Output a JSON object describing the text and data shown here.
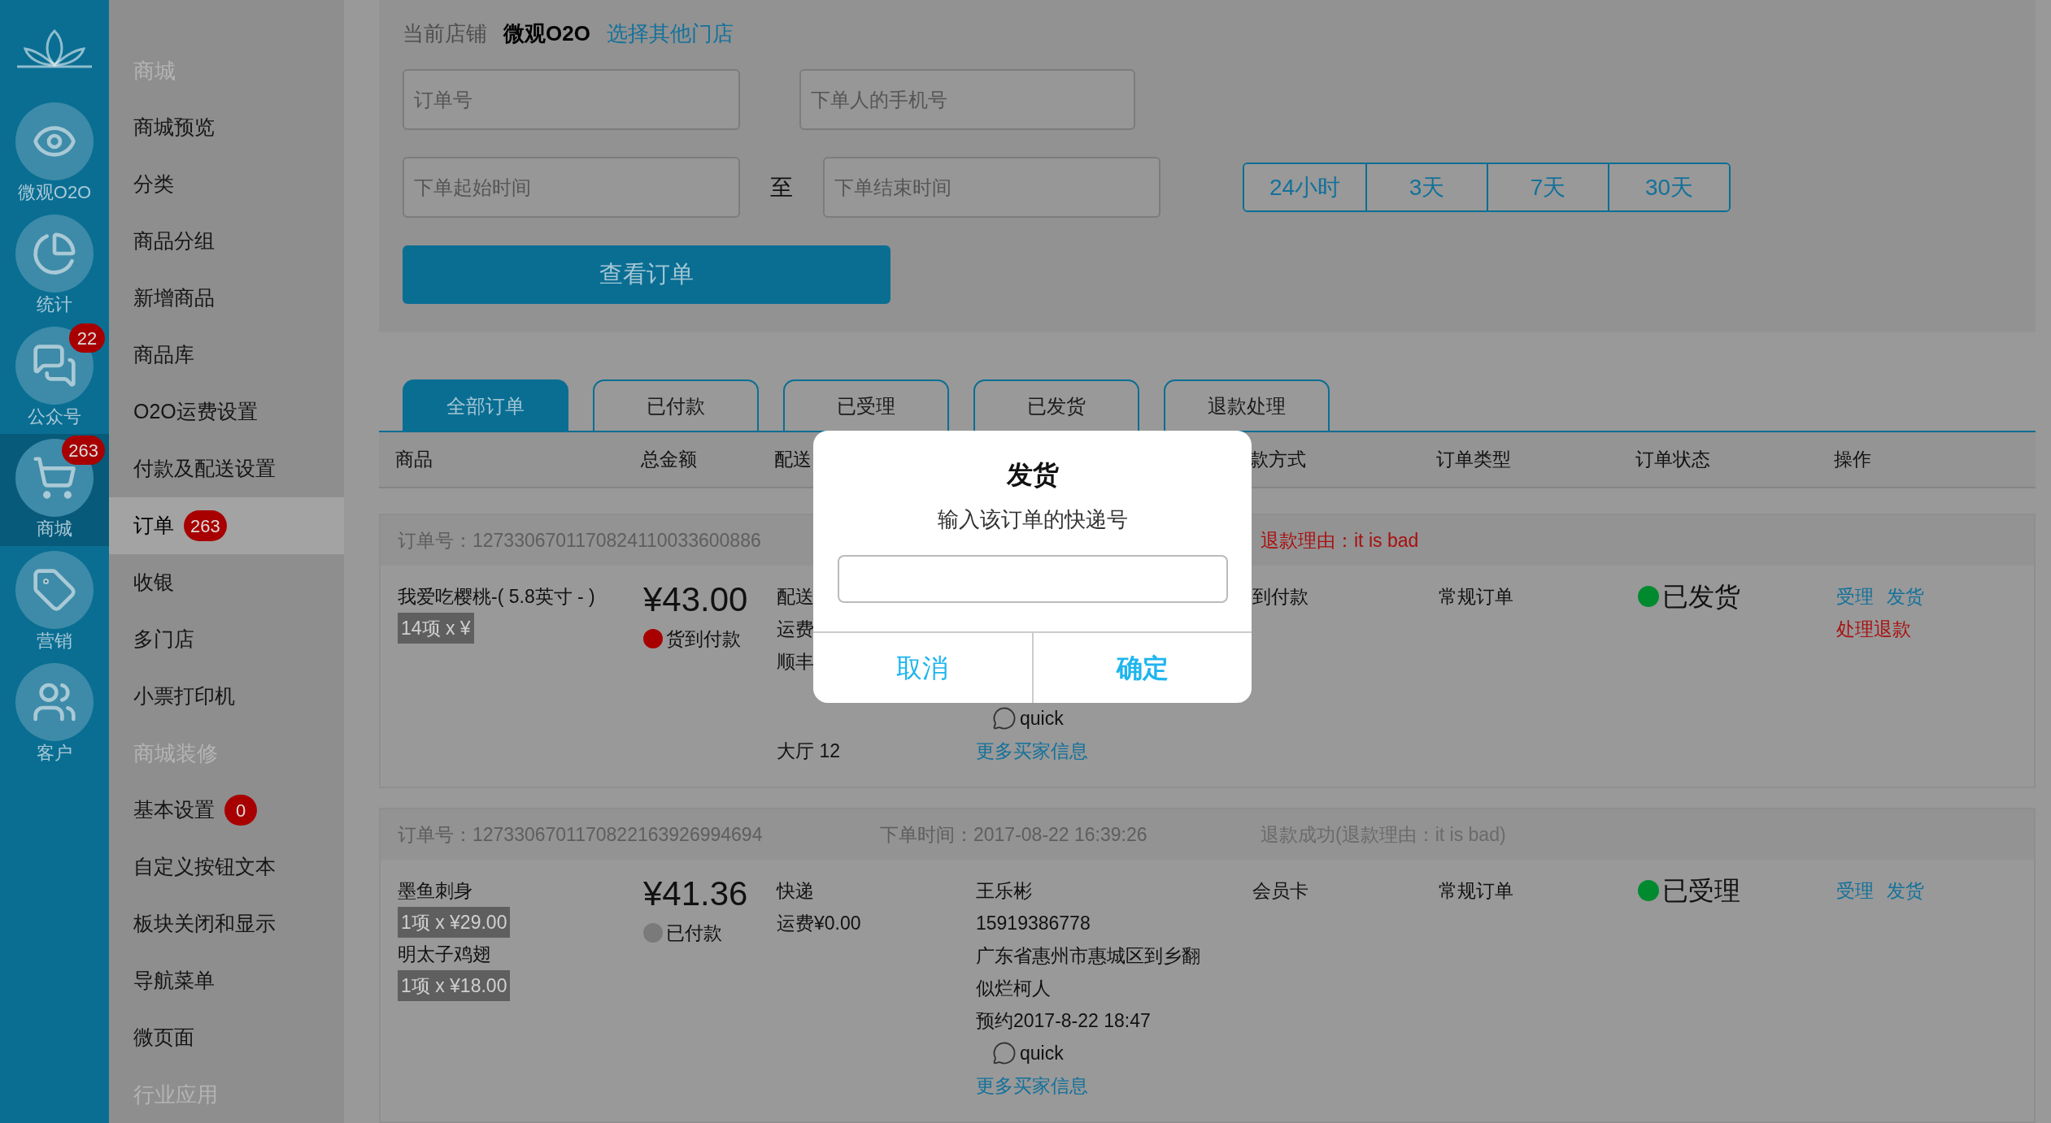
{
  "nav": [
    {
      "label": "微观O2O",
      "selected": false
    },
    {
      "label": "统计",
      "selected": false
    },
    {
      "label": "公众号",
      "badge": "22",
      "selected": false
    },
    {
      "label": "商城",
      "badge": "263",
      "selected": true
    },
    {
      "label": "营销",
      "selected": false
    },
    {
      "label": "客户",
      "selected": false
    }
  ],
  "menu": [
    {
      "kind": "header",
      "label": "商城"
    },
    {
      "kind": "item",
      "label": "商城预览",
      "selected": false
    },
    {
      "kind": "item",
      "label": "分类",
      "selected": false
    },
    {
      "kind": "item",
      "label": "商品分组",
      "selected": false
    },
    {
      "kind": "item",
      "label": "新增商品",
      "selected": false
    },
    {
      "kind": "item",
      "label": "商品库",
      "selected": false
    },
    {
      "kind": "item",
      "label": "O2O运费设置",
      "selected": false
    },
    {
      "kind": "item",
      "label": "付款及配送设置",
      "selected": false
    },
    {
      "kind": "item",
      "label": "订单",
      "badge": "263",
      "selected": true
    },
    {
      "kind": "item",
      "label": "收银",
      "selected": false
    },
    {
      "kind": "item",
      "label": "多门店",
      "selected": false
    },
    {
      "kind": "item",
      "label": "小票打印机",
      "selected": false
    },
    {
      "kind": "header",
      "label": "商城装修"
    },
    {
      "kind": "item",
      "label": "基本设置",
      "badge": "0",
      "selected": false
    },
    {
      "kind": "item",
      "label": "自定义按钮文本",
      "selected": false
    },
    {
      "kind": "item",
      "label": "板块关闭和显示",
      "selected": false
    },
    {
      "kind": "item",
      "label": "导航菜单",
      "selected": false
    },
    {
      "kind": "item",
      "label": "微页面",
      "selected": false
    },
    {
      "kind": "header",
      "label": "行业应用"
    }
  ],
  "store": {
    "label": "当前店铺",
    "name": "微观O2O",
    "link": "选择其他门店"
  },
  "filters": {
    "order_no": {
      "placeholder": "订单号"
    },
    "phone": {
      "placeholder": "下单人的手机号"
    },
    "start": {
      "placeholder": "下单起始时间"
    },
    "to": "至",
    "end": {
      "placeholder": "下单结束时间"
    },
    "ranges": [
      "24小时",
      "3天",
      "7天",
      "30天"
    ],
    "submit": "查看订单"
  },
  "tabs": [
    {
      "label": "全部订单",
      "selected": true
    },
    {
      "label": "已付款",
      "selected": false
    },
    {
      "label": "已受理",
      "selected": false
    },
    {
      "label": "已发货",
      "selected": false
    },
    {
      "label": "退款处理",
      "selected": false
    }
  ],
  "columns": [
    "商品",
    "总金额",
    "配送",
    "",
    "款方式",
    "订单类型",
    "订单状态",
    "操作"
  ],
  "orders": [
    {
      "number": "订单号：1273306701170824110033600886",
      "refund": {
        "text": "退款理由：it is bad",
        "kind": "pending"
      },
      "products": [
        {
          "name": "我爱吃樱桃-( 5.8英寸 - )",
          "qty": "14项 x ¥"
        }
      ],
      "total": "¥43.00",
      "pay_status": {
        "label": "货到付款",
        "color": "#a80000"
      },
      "delivery": {
        "lines": [
          "配送",
          "运费",
          "顺丰"
        ],
        "tail": "大厅 12"
      },
      "buyer": {
        "note": "quick",
        "link": "更多买家信息"
      },
      "payment": "到付款",
      "type": "常规订单",
      "status": {
        "label": "已发货",
        "color": "#008a30"
      },
      "actions": [
        {
          "label": "受理",
          "kind": "normal"
        },
        {
          "label": "发货",
          "kind": "normal"
        },
        {
          "label": "处理退款",
          "kind": "danger"
        }
      ]
    },
    {
      "number": "订单号：1273306701170822163926994694",
      "time": "下单时间：2017-08-22 16:39:26",
      "refund": {
        "text": "退款成功(退款理由：it is bad)",
        "kind": "done"
      },
      "products": [
        {
          "name": "墨鱼刺身",
          "qty": "1项 x ¥29.00"
        },
        {
          "name": "明太子鸡翅",
          "qty": "1项 x ¥18.00"
        }
      ],
      "total": "¥41.36",
      "pay_status": {
        "label": "已付款",
        "color": "#7a7a7a"
      },
      "delivery": {
        "lines": [
          "快递",
          "运费¥0.00"
        ]
      },
      "buyer": {
        "lines": [
          "王乐彬",
          "15919386778",
          "广东省惠州市惠城区到乡翻",
          "似烂柯人",
          "预约2017-8-22 18:47"
        ],
        "note": "quick",
        "link": "更多买家信息"
      },
      "payment": "会员卡",
      "type": "常规订单",
      "status": {
        "label": "已受理",
        "color": "#008a30"
      },
      "actions": [
        {
          "label": "受理",
          "kind": "normal"
        },
        {
          "label": "发货",
          "kind": "normal"
        }
      ]
    }
  ],
  "dialog": {
    "title": "发货",
    "message": "输入该订单的快递号",
    "cancel": "取消",
    "confirm": "确定"
  }
}
